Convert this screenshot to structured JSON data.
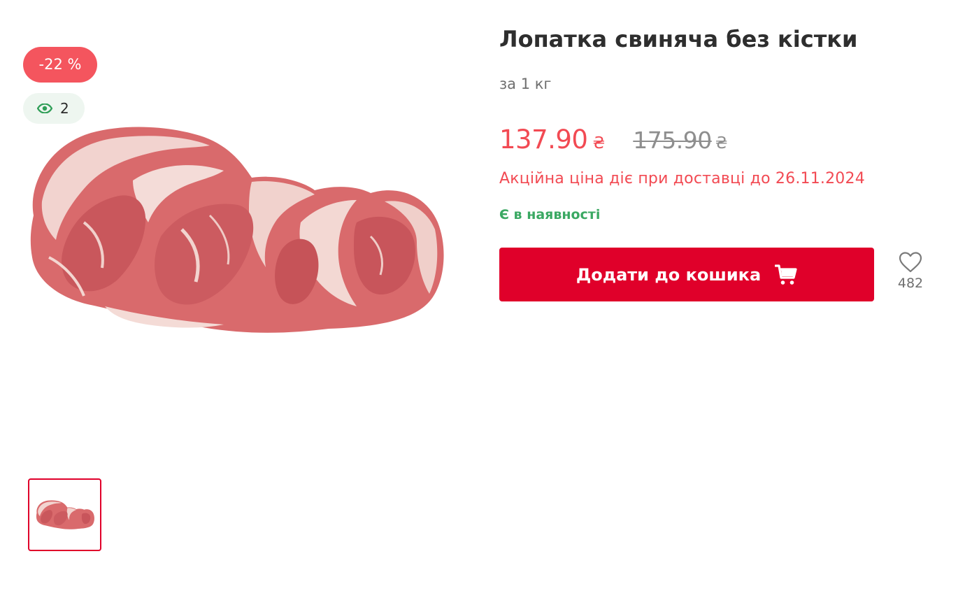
{
  "gallery": {
    "discount_badge": "-22 %",
    "views_count": "2",
    "main_image_alt": "Лопатка свиняча без кістки"
  },
  "product": {
    "title": "Лопатка свиняча без кістки",
    "unit": "за 1 кг",
    "price_current": "137.90",
    "price_old": "175.90",
    "currency": "₴",
    "promo_note": "Акційна ціна діє при доставці до 26.11.2024",
    "stock_status": "Є в наявності",
    "add_to_cart_label": "Додати до кошика",
    "favorites_count": "482"
  },
  "colors": {
    "accent": "#e0002a",
    "sale": "#f24a53",
    "in_stock": "#3aa862",
    "badge": "#f4555e"
  },
  "icons": [
    "eye-icon",
    "cart-icon",
    "heart-icon"
  ]
}
